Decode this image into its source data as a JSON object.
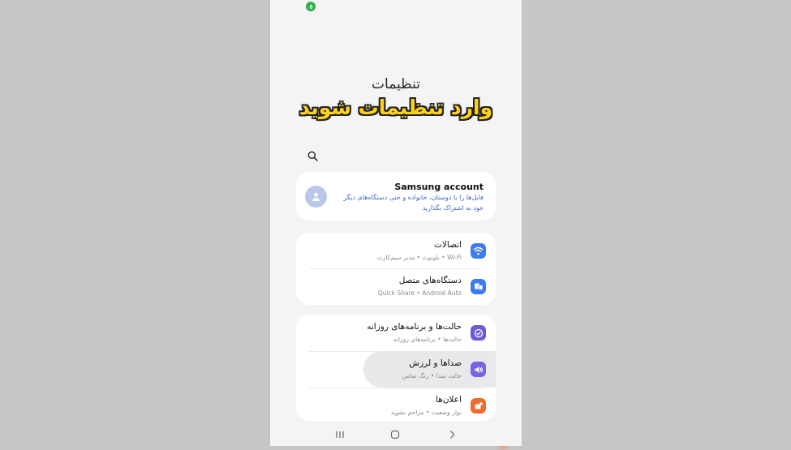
{
  "header": {
    "title": "تنظیمات",
    "overlay_caption": "وارد تنظیمات شوید"
  },
  "account": {
    "title": "Samsung account",
    "description": "فایل‌ها را با دوستان، خانواده و حتی دستگاه‌های دیگر خود به اشتراک بگذارید"
  },
  "settings_groups": [
    {
      "items": [
        {
          "label": "اتصالات",
          "sub": "Wi-Fi • بلوتوث • مدیر سیم‌کارت",
          "icon": "wifi-icon",
          "color": "#3d7bf2"
        },
        {
          "label": "دستگاه‌های متصل",
          "sub": "Quick Share • Android Auto",
          "icon": "connected-devices-icon",
          "color": "#3d7bf2"
        }
      ]
    },
    {
      "items": [
        {
          "label": "حالت‌ها و برنامه‌های روزانه",
          "sub": "حالت‌ها • برنامه‌های روزانه",
          "icon": "modes-check-icon",
          "color": "#6a5cd6"
        },
        {
          "label": "صداها و لرزش",
          "sub": "حالت صدا • زنگ تماس",
          "icon": "speaker-icon",
          "color": "#7a63e0"
        },
        {
          "label": "اعلان‌ها",
          "sub": "نوار وضعیت • مزاحم نشوید",
          "icon": "notification-icon",
          "color": "#ee6b2d"
        }
      ]
    }
  ],
  "colors": {
    "accent_blue": "#3d7bf2",
    "overlay_yellow": "#ffd21a",
    "mic_green": "#2fb14b"
  },
  "navbar": {
    "icons": [
      "recent-apps-icon",
      "home-icon",
      "back-icon"
    ]
  }
}
